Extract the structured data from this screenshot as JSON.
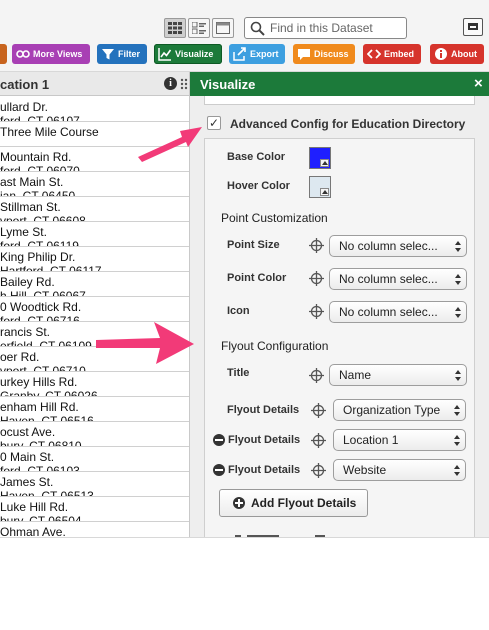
{
  "toolbar": {
    "search_placeholder": "Find in this Dataset",
    "buttons": {
      "more_views": "More Views",
      "filter": "Filter",
      "visualize": "Visualize",
      "export": "Export",
      "discuss": "Discuss",
      "embed": "Embed",
      "about": "About"
    },
    "colors": {
      "more_views": "#a83fb4",
      "filter": "#2472bd",
      "visualize": "#1c7a3a",
      "export": "#3d9fe0",
      "discuss": "#f08a1c",
      "embed": "#d6342c",
      "about": "#d6342c"
    }
  },
  "grid": {
    "column_title": "cation 1",
    "rows": [
      {
        "line1": "ullard Dr.",
        "line2": "ford, CT 06107"
      },
      {
        "line1": "Three Mile Course",
        "line2": ""
      },
      {
        "line1": "Mountain Rd.",
        "line2": "ford, CT 06070"
      },
      {
        "line1": "ast Main St.",
        "line2": "ian, CT 06450"
      },
      {
        "line1": "Stillman St.",
        "line2": "vport, CT 06608"
      },
      {
        "line1": "Lyme St.",
        "line2": "ford, CT 06119"
      },
      {
        "line1": "King Philip Dr.",
        "line2": "Hartford, CT 06117"
      },
      {
        "line1": "Bailey Rd.",
        "line2": "h Hill, CT 06067"
      },
      {
        "line1": "0 Woodtick Rd.",
        "line2": "ford, CT 06716"
      },
      {
        "line1": "rancis St.",
        "line2": "erfield, CT 06109"
      },
      {
        "line1": "oer Rd.",
        "line2": "vport, CT 06710"
      },
      {
        "line1": "urkey Hills Rd.",
        "line2": "Granby, CT 06026"
      },
      {
        "line1": "enham Hill Rd.",
        "line2": "Haven, CT 06516"
      },
      {
        "line1": "ocust Ave.",
        "line2": "bury, CT 06810"
      },
      {
        "line1": "0 Main St.",
        "line2": "ford, CT 06103"
      },
      {
        "line1": "James St.",
        "line2": "Haven, CT 06513"
      },
      {
        "line1": "Luke Hill Rd.",
        "line2": "bury, CT 06504"
      },
      {
        "line1": "Ohman Ave.",
        "line2": ""
      }
    ]
  },
  "panel": {
    "title": "Visualize",
    "close": "×",
    "advanced_label": "Advanced Config for Education Directory",
    "checkmark": "✓",
    "base_color_label": "Base Color",
    "base_color": "#1f1fff",
    "hover_color_label": "Hover Color",
    "hover_color": "#dde8f0",
    "point_section": "Point Customization",
    "point_size_label": "Point Size",
    "point_size_value": "No column selec...",
    "point_color_label": "Point Color",
    "point_color_value": "No column selec...",
    "icon_label": "Icon",
    "icon_value": "No column selec...",
    "flyout_section": "Flyout Configuration",
    "title_label": "Title",
    "title_value": "Name",
    "flyout_details": [
      {
        "label": "Flyout Details",
        "value": "Organization Type",
        "removable": false
      },
      {
        "label": "Flyout Details",
        "value": "Location 1",
        "removable": true
      },
      {
        "label": "Flyout Details",
        "value": "Website",
        "removable": true
      }
    ],
    "add_flyout_label": "Add Flyout Details"
  },
  "annotation_color": "#f23a78"
}
